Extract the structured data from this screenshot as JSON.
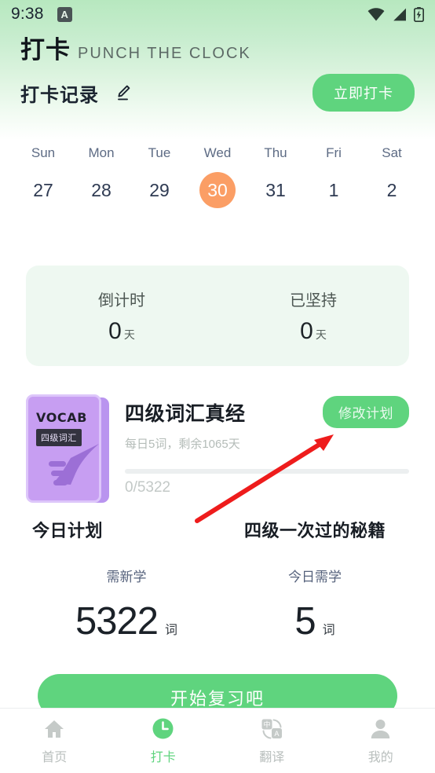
{
  "status_bar": {
    "time": "9:38",
    "app_badge": "A",
    "icons": [
      "wifi-icon",
      "cellular-signal-icon",
      "battery-charging-icon"
    ]
  },
  "brand": {
    "title_cn": "打卡",
    "title_en": "PUNCH THE CLOCK"
  },
  "record_header": {
    "title": "打卡记录",
    "edit_icon": "pencil-icon",
    "punch_button": "立即打卡"
  },
  "calendar": {
    "days": [
      {
        "dow": "Sun",
        "num": "27",
        "today": false
      },
      {
        "dow": "Mon",
        "num": "28",
        "today": false
      },
      {
        "dow": "Tue",
        "num": "29",
        "today": false
      },
      {
        "dow": "Wed",
        "num": "30",
        "today": true
      },
      {
        "dow": "Thu",
        "num": "31",
        "today": false
      },
      {
        "dow": "Fri",
        "num": "1",
        "today": false
      },
      {
        "dow": "Sat",
        "num": "2",
        "today": false
      }
    ],
    "today_highlight_color": "#fb9e65"
  },
  "stats": {
    "countdown": {
      "label": "倒计时",
      "value": "0",
      "unit": "天"
    },
    "streak": {
      "label": "已坚持",
      "value": "0",
      "unit": "天"
    }
  },
  "book": {
    "cover": {
      "brand_text": "VOCAB",
      "badge_text": "四级词汇",
      "color": "#c79ef2",
      "accent_color": "#9c6fd6"
    },
    "title": "四级词汇真经",
    "subtitle": "每日5词，剩余1065天",
    "edit_plan_button": "修改计划",
    "progress_text": "0/5322",
    "progress_percent": 0
  },
  "plans": [
    {
      "title": "今日计划",
      "sub": "需新学",
      "number": "5322",
      "unit": "词"
    },
    {
      "title": "四级一次过的秘籍",
      "sub": "今日需学",
      "number": "5",
      "unit": "词"
    }
  ],
  "start_button": {
    "label": "开始复习吧"
  },
  "bottom_nav": [
    {
      "label": "首页",
      "icon": "home-icon",
      "active": false
    },
    {
      "label": "打卡",
      "icon": "clock-icon",
      "active": true
    },
    {
      "label": "翻译",
      "icon": "translate-icon",
      "active": false
    },
    {
      "label": "我的",
      "icon": "person-icon",
      "active": false
    }
  ],
  "annotation": {
    "type": "red-arrow",
    "color": "#ee1c1c",
    "points_to": "修改计划"
  },
  "theme": {
    "primary_green": "#5fd47e",
    "header_gradient_top": "#b7e8bf",
    "card_bg": "#eef8f1",
    "today_orange": "#fb9e65"
  }
}
